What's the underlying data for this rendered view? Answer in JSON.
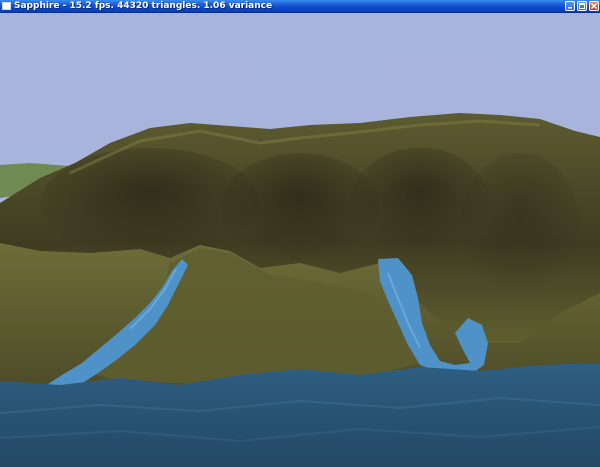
{
  "window": {
    "title": "Sapphire - 15.2 fps. 44320 triangles. 1.06 variance"
  },
  "title_bar": {
    "icons": [
      "app-icon",
      "minimize-icon",
      "maximize-icon",
      "close-icon"
    ]
  },
  "scene": {
    "description_colors": {
      "sky": "#a9b5dd",
      "terrain_dark": "#3f3d24",
      "terrain_green": "#6b6a35",
      "water_deep": "#2c5a7a",
      "water_stream": "#4f93c9"
    }
  }
}
